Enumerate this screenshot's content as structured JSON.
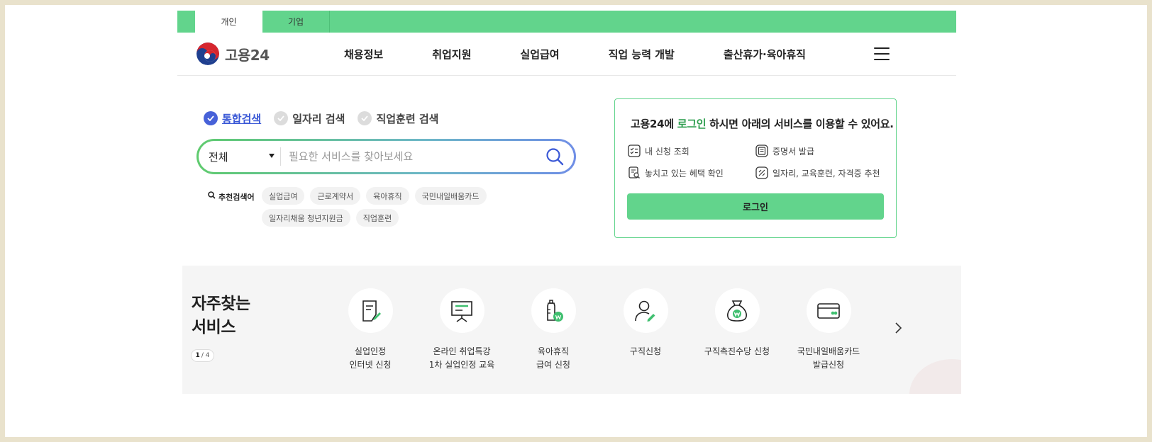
{
  "tabs": [
    {
      "label": "개인",
      "active": true
    },
    {
      "label": "기업",
      "active": false
    }
  ],
  "logo": {
    "text": "고용24"
  },
  "nav": [
    "채용정보",
    "취업지원",
    "실업급여",
    "직업 능력 개발",
    "출산휴가·육아휴직"
  ],
  "search": {
    "radios": [
      {
        "label": "통합검색",
        "selected": true
      },
      {
        "label": "일자리 검색",
        "selected": false
      },
      {
        "label": "직업훈련 검색",
        "selected": false
      }
    ],
    "select_value": "전체",
    "placeholder": "필요한 서비스를 찾아보세요",
    "recommend_label": "추천검색어",
    "chips": [
      "실업급여",
      "근로계약서",
      "육아휴직",
      "국민내일배움카드",
      "일자리채움 청년지원금",
      "직업훈련"
    ]
  },
  "login": {
    "title_pre": "고용24에 ",
    "title_highlight": "로그인",
    "title_post": " 하시면 아래의 서비스를 이용할 수 있어요.",
    "services": [
      "내 신청 조회",
      "증명서 발급",
      "놓치고 있는 혜택 확인",
      "일자리, 교육훈련, 자격증 추천"
    ],
    "button": "로그인"
  },
  "frequent": {
    "title_line1": "자주찾는",
    "title_line2": "서비스",
    "page_current": "1",
    "page_total": "/ 4",
    "items": [
      {
        "line1": "실업인정",
        "line2": "인터넷 신청",
        "icon": "document-edit-icon"
      },
      {
        "line1": "온라인 취업특강",
        "line2": "1차 실업인정 교육",
        "icon": "presentation-board-icon"
      },
      {
        "line1": "육아휴직",
        "line2": "급여 신청",
        "icon": "baby-bottle-icon"
      },
      {
        "line1": "구직신청",
        "line2": "",
        "icon": "person-edit-icon"
      },
      {
        "line1": "구직촉진수당 신청",
        "line2": "",
        "icon": "money-bag-icon"
      },
      {
        "line1": "국민내일배움카드",
        "line2": "발급신청",
        "icon": "card-icon"
      }
    ]
  },
  "colors": {
    "brand_green": "#62d48c",
    "radio_blue": "#4761d8",
    "highlight_green": "#2e9e4f"
  }
}
